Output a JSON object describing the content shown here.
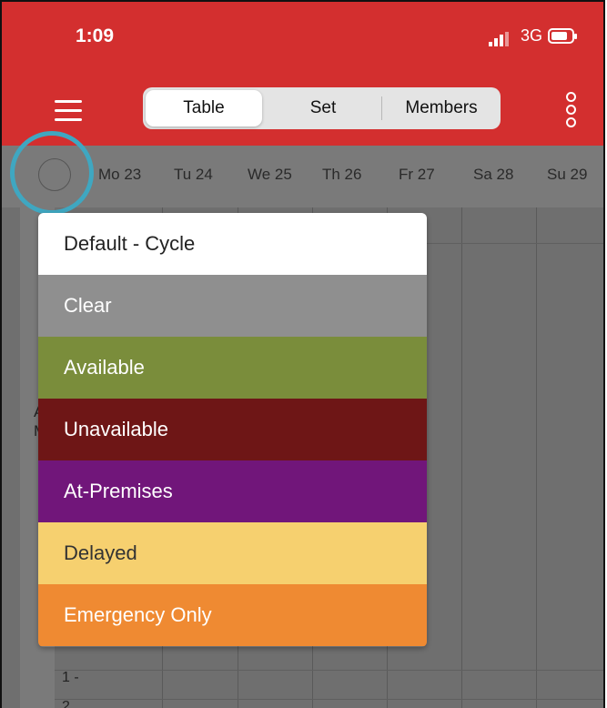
{
  "status_bar": {
    "time": "1:09",
    "network": "3G"
  },
  "nav": {
    "tabs": [
      {
        "label": "Table"
      },
      {
        "label": "Set"
      },
      {
        "label": "Members"
      }
    ],
    "active_tab": "Table"
  },
  "days": [
    "Mo 23",
    "Tu 24",
    "We 25",
    "Th 26",
    "Fr 27",
    "Sa 28",
    "Su 29"
  ],
  "row_labels": [
    "1 -",
    "2"
  ],
  "edge_text": [
    "A",
    "M"
  ],
  "menu": {
    "items": [
      {
        "label": "Default - Cycle",
        "bg": "#ffffff",
        "fg": "#222222"
      },
      {
        "label": "Clear",
        "bg": "#8f8f8f",
        "fg": "#ffffff"
      },
      {
        "label": "Available",
        "bg": "#7a8d3b",
        "fg": "#ffffff"
      },
      {
        "label": "Unavailable",
        "bg": "#6e1616",
        "fg": "#ffffff"
      },
      {
        "label": "At-Premises",
        "bg": "#71167a",
        "fg": "#ffffff"
      },
      {
        "label": "Delayed",
        "bg": "#f6d06f",
        "fg": "#333333"
      },
      {
        "label": "Emergency Only",
        "bg": "#ef8a32",
        "fg": "#ffffff"
      }
    ]
  },
  "colors": {
    "header": "#d32f2f",
    "highlight_ring": "#3fa7c1",
    "overlay": "#6f6f6f"
  }
}
